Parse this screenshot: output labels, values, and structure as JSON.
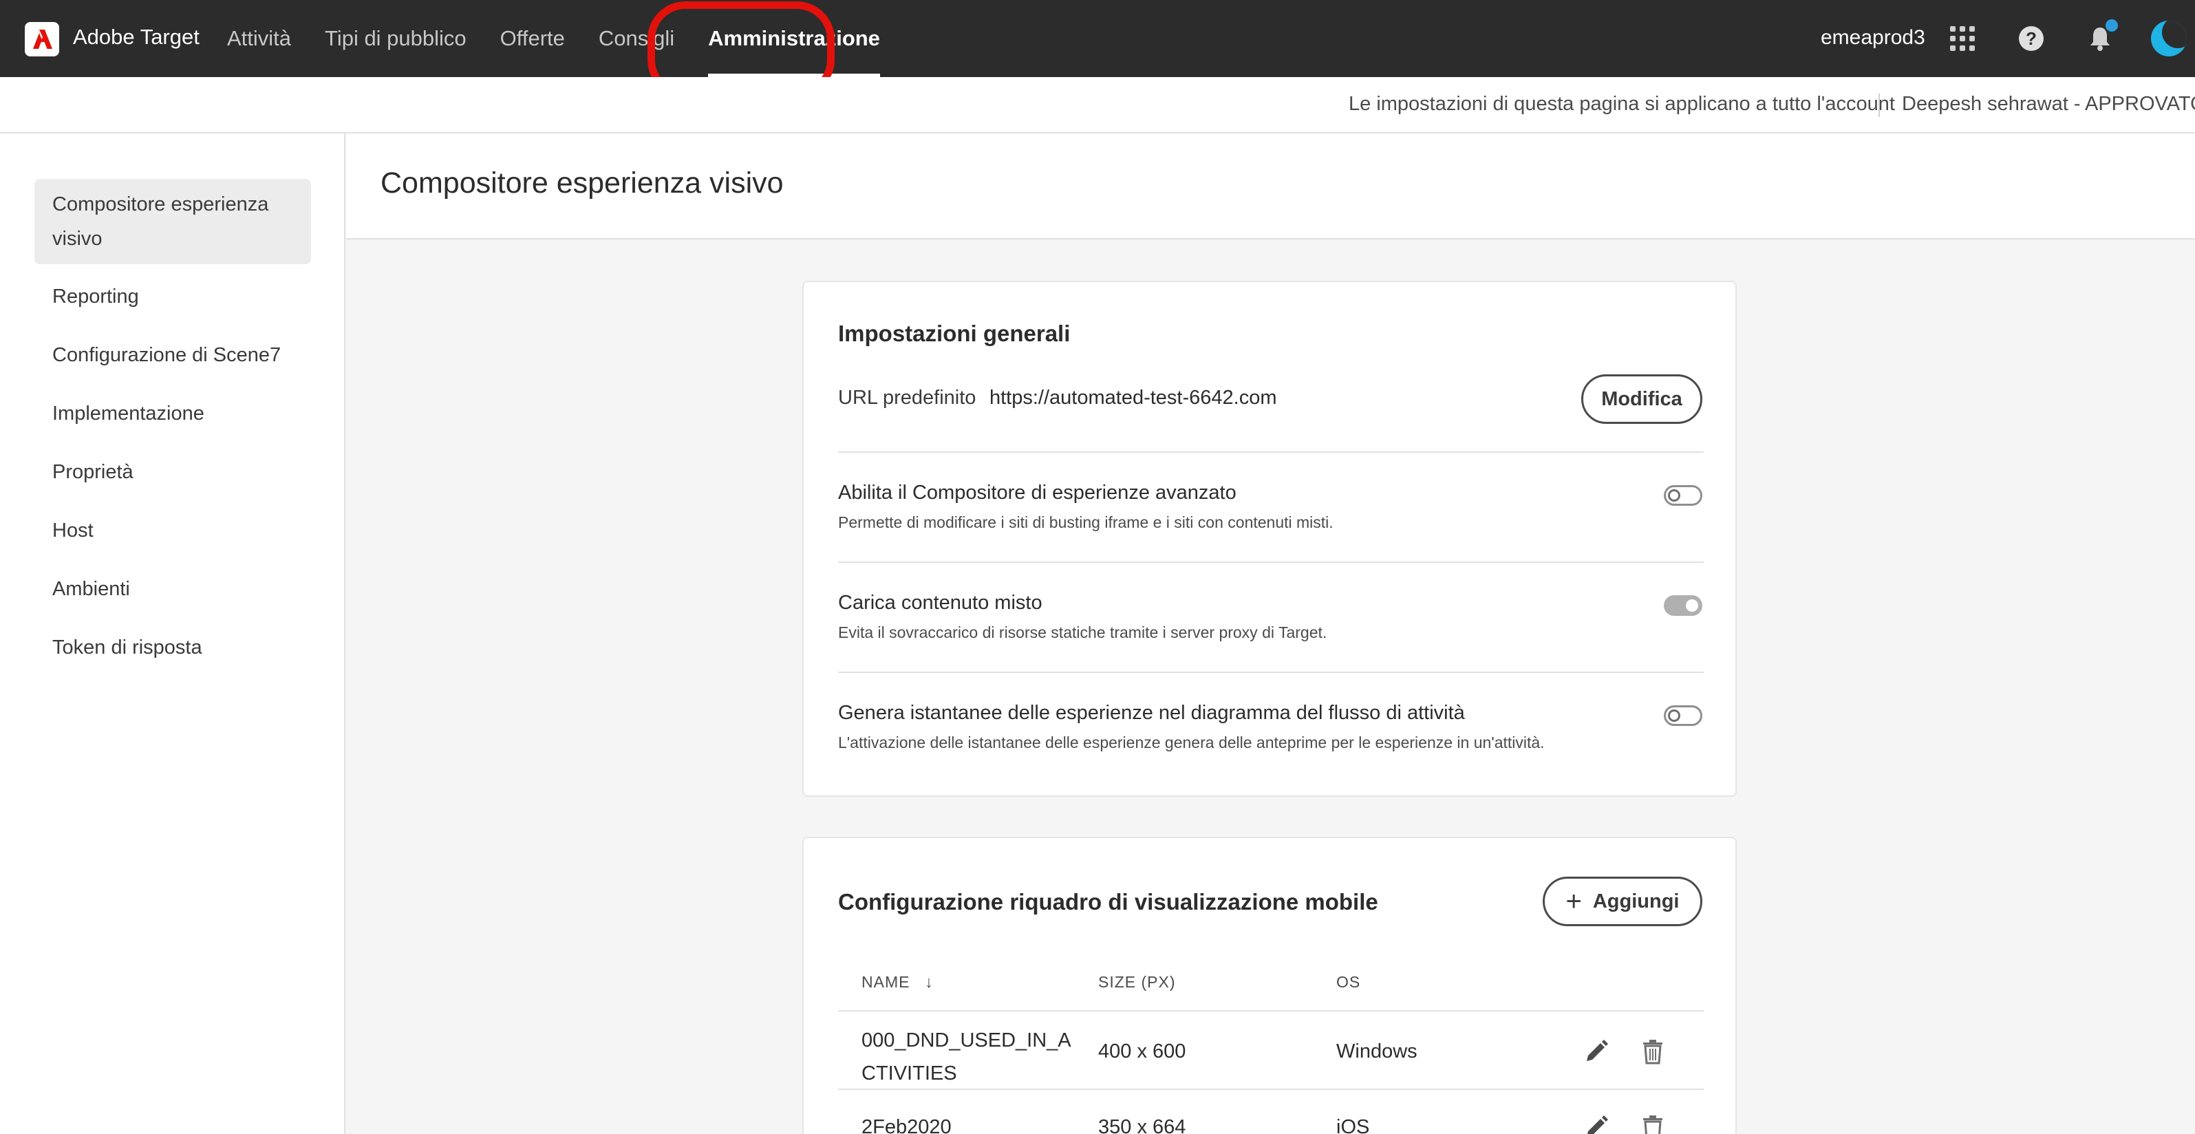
{
  "header": {
    "app_name": "Adobe Target",
    "nav": [
      "Attività",
      "Tipi di pubblico",
      "Offerte",
      "Consigli",
      "Amministrazione"
    ],
    "active_nav": "Amministrazione",
    "account": "emeaprod3",
    "help_glyph": "?",
    "icons": [
      "apps-grid-icon",
      "help-icon",
      "bell-icon",
      "avatar"
    ],
    "colors": {
      "bar": "#2c2c2c",
      "highlight": "#e3110b",
      "notification": "#2d9cdb"
    }
  },
  "subheader": {
    "note": "Le impostazioni di questa pagina si applicano a tutto l'account",
    "user": "Deepesh sehrawat - APPROVATORE"
  },
  "sidebar": {
    "items": [
      "Compositore esperienza visivo",
      "Reporting",
      "Configurazione di Scene7",
      "Implementazione",
      "Proprietà",
      "Host",
      "Ambienti",
      "Token di risposta"
    ],
    "active": "Compositore esperienza visivo"
  },
  "main": {
    "title": "Compositore esperienza visivo",
    "general": {
      "title": "Impostazioni generali",
      "url_label": "URL predefinito",
      "url_value": "https://automated-test-6642.com",
      "edit_button": "Modifica",
      "settings": [
        {
          "title": "Abilita il Compositore di esperienze avanzato",
          "desc": "Permette di modificare i siti di busting iframe e i siti con contenuti misti.",
          "enabled": false
        },
        {
          "title": "Carica contenuto misto",
          "desc": "Evita il sovraccarico di risorse statiche tramite i server proxy di Target.",
          "enabled": true
        },
        {
          "title": "Genera istantanee delle esperienze nel diagramma del flusso di attività",
          "desc": "L'attivazione delle istantanee delle esperienze genera delle anteprime per le esperienze in un'attività.",
          "enabled": false
        }
      ]
    },
    "mobile": {
      "title": "Configurazione riquadro di visualizzazione mobile",
      "add_button": "Aggiungi",
      "add_glyph": "+",
      "columns": [
        "NAME",
        "SIZE (PX)",
        "OS"
      ],
      "sort_glyph": "↓",
      "rows": [
        {
          "name_line1": "000_DND_USED_IN_A",
          "name_line2": "CTIVITIES",
          "size": "400 x 600",
          "os": "Windows"
        },
        {
          "name_line1": "2Feb2020",
          "name_line2": "",
          "size": "350 x 664",
          "os": "iOS"
        }
      ]
    }
  }
}
